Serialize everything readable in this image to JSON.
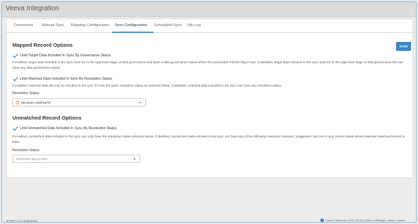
{
  "app": {
    "title": "Veeva Integration"
  },
  "tabs": [
    {
      "label": "Connection"
    },
    {
      "label": "Manual Sync"
    },
    {
      "label": "Mapping Configuration"
    },
    {
      "label": "Sync Configuration",
      "active": true
    },
    {
      "label": "Scheduled Sync"
    },
    {
      "label": "Job Log"
    }
  ],
  "toolbar": {
    "save_label": "SAVE"
  },
  "mapped": {
    "title": "Mapped Record Options",
    "governance": {
      "checked": true,
      "label": "Limit Target Data Included In Sync By Governance Status",
      "description": "If enabled, target data included in the sync must be in the Approved stage of data governance and have a data governance status where the associated Publish flag is true. If disabled, target data included in the sync must be in the Approved stage of data governance but can have any data governance status."
    },
    "resolution": {
      "checked": true,
      "label": "Limit Matched Data Included In Sync By Resolution Status",
      "description": "If enabled, matched data will only be included in the sync if it has the same resolution status as selected below. If disabled, matched data included in the sync can have any resolution status."
    },
    "status_field": {
      "label": "Resolution Status",
      "value": "REVIEW COMPLETE",
      "status_color": "#e59a2a"
    }
  },
  "unmatched": {
    "title": "Unmatched Record Options",
    "resolution": {
      "checked": true,
      "label": "Limit Unmatched Data Included In Sync By Resolution Status",
      "description": "If enabled, unmatched data included in the sync can only have the resolution status selected below. If disabled, unmatched data included in the sync can have any of the following resolution statuses: Suggested, Not Set or any custom status where Maintain Matched Record is false."
    },
    "status_field": {
      "label": "Resolution Status",
      "placeholder": "NOTHING SELECTED"
    }
  },
  "footer": {
    "version": "IPORFY 21.4 Enterprise",
    "timezone": "Current Timezone: (UTC+00:00) Dublin, Edinburgh, Lisbon, London"
  },
  "colors": {
    "accent": "#3b87c9",
    "check": "#4a90c8"
  },
  "icons": {
    "check": "check-icon",
    "caret": "chevron-down-icon",
    "status": "status-ring-icon",
    "info": "info-icon"
  }
}
